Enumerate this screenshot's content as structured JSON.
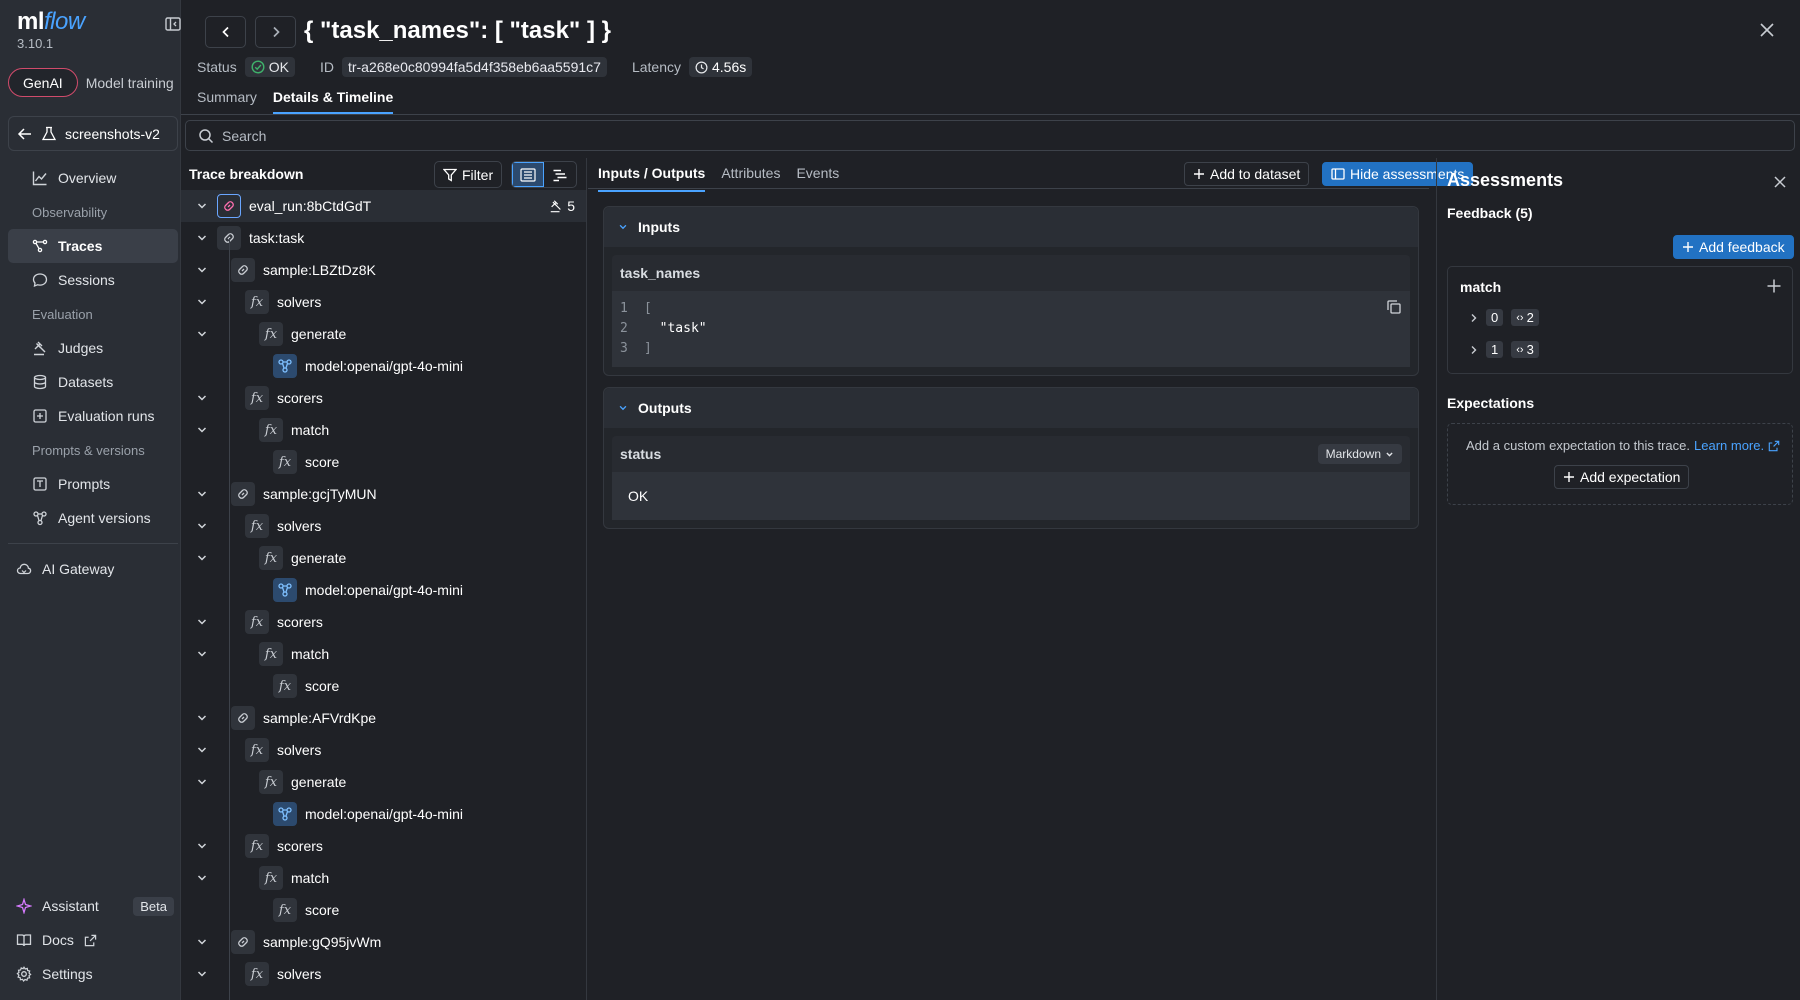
{
  "app": {
    "logo_ml": "ml",
    "logo_flow": "flow",
    "version": "3.10.1"
  },
  "sidebar": {
    "modes": [
      "GenAI",
      "Model training"
    ],
    "experiment": "screenshots-v2",
    "nav": {
      "overview": "Overview",
      "section_observability": "Observability",
      "traces": "Traces",
      "sessions": "Sessions",
      "section_evaluation": "Evaluation",
      "judges": "Judges",
      "datasets": "Datasets",
      "evaluation_runs": "Evaluation runs",
      "section_prompts": "Prompts & versions",
      "prompts": "Prompts",
      "agent_versions": "Agent versions",
      "ai_gateway": "AI Gateway"
    },
    "bottom": {
      "assistant": "Assistant",
      "beta": "Beta",
      "docs": "Docs",
      "settings": "Settings"
    }
  },
  "header": {
    "title": "{ \"task_names\": [ \"task\" ] }",
    "status_label": "Status",
    "status_value": "OK",
    "id_label": "ID",
    "id_value": "tr-a268e0c80994fa5d4f358eb6aa5591c7",
    "latency_label": "Latency",
    "latency_value": "4.56s",
    "tabs": [
      "Summary",
      "Details & Timeline"
    ]
  },
  "search": {
    "placeholder": "Search"
  },
  "tree": {
    "title": "Trace breakdown",
    "filter_label": "Filter",
    "root": {
      "label": "eval_run:8bCtdGdT",
      "count": "5"
    },
    "rows": [
      {
        "label": "task:task",
        "kind": "link",
        "depth": 1
      },
      {
        "label": "sample:LBZtDz8K",
        "kind": "link",
        "depth": 2
      },
      {
        "label": "solvers",
        "kind": "fx",
        "depth": 3
      },
      {
        "label": "generate",
        "kind": "fx",
        "depth": 4
      },
      {
        "label": "model:openai/gpt-4o-mini",
        "kind": "model",
        "depth": 5
      },
      {
        "label": "scorers",
        "kind": "fx",
        "depth": 3
      },
      {
        "label": "match",
        "kind": "fx",
        "depth": 4
      },
      {
        "label": "score",
        "kind": "fx",
        "depth": 5
      },
      {
        "label": "sample:gcjTyMUN",
        "kind": "link",
        "depth": 2
      },
      {
        "label": "solvers",
        "kind": "fx",
        "depth": 3
      },
      {
        "label": "generate",
        "kind": "fx",
        "depth": 4
      },
      {
        "label": "model:openai/gpt-4o-mini",
        "kind": "model",
        "depth": 5
      },
      {
        "label": "scorers",
        "kind": "fx",
        "depth": 3
      },
      {
        "label": "match",
        "kind": "fx",
        "depth": 4
      },
      {
        "label": "score",
        "kind": "fx",
        "depth": 5
      },
      {
        "label": "sample:AFVrdKpe",
        "kind": "link",
        "depth": 2
      },
      {
        "label": "solvers",
        "kind": "fx",
        "depth": 3
      },
      {
        "label": "generate",
        "kind": "fx",
        "depth": 4
      },
      {
        "label": "model:openai/gpt-4o-mini",
        "kind": "model",
        "depth": 5
      },
      {
        "label": "scorers",
        "kind": "fx",
        "depth": 3
      },
      {
        "label": "match",
        "kind": "fx",
        "depth": 4
      },
      {
        "label": "score",
        "kind": "fx",
        "depth": 5
      },
      {
        "label": "sample:gQ95jvWm",
        "kind": "link",
        "depth": 2
      },
      {
        "label": "solvers",
        "kind": "fx",
        "depth": 3
      }
    ]
  },
  "detail": {
    "tabs": [
      "Inputs / Outputs",
      "Attributes",
      "Events"
    ],
    "add_to_dataset": "Add to dataset",
    "hide_assessments": "Hide assessments",
    "inputs": {
      "title": "Inputs",
      "field": "task_names",
      "lines": [
        {
          "n": "1",
          "text": "["
        },
        {
          "n": "2",
          "text": "  \"task\""
        },
        {
          "n": "3",
          "text": "]"
        }
      ]
    },
    "outputs": {
      "title": "Outputs",
      "field": "status",
      "format": "Markdown",
      "value": "OK"
    }
  },
  "assessments": {
    "title": "Assessments",
    "feedback_title": "Feedback (5)",
    "add_feedback": "Add feedback",
    "match": {
      "name": "match",
      "rows": [
        {
          "key": "0",
          "value": "2"
        },
        {
          "key": "1",
          "value": "3"
        }
      ]
    },
    "expectations_title": "Expectations",
    "expectation_text": "Add a custom expectation to this trace.",
    "learn_more": "Learn more.",
    "add_expectation": "Add expectation"
  },
  "colors": {
    "accent": "#4aa3ff",
    "primary_button": "#2272c3",
    "genai_border": "#d04b6b",
    "ok_green": "#3fb26b"
  }
}
